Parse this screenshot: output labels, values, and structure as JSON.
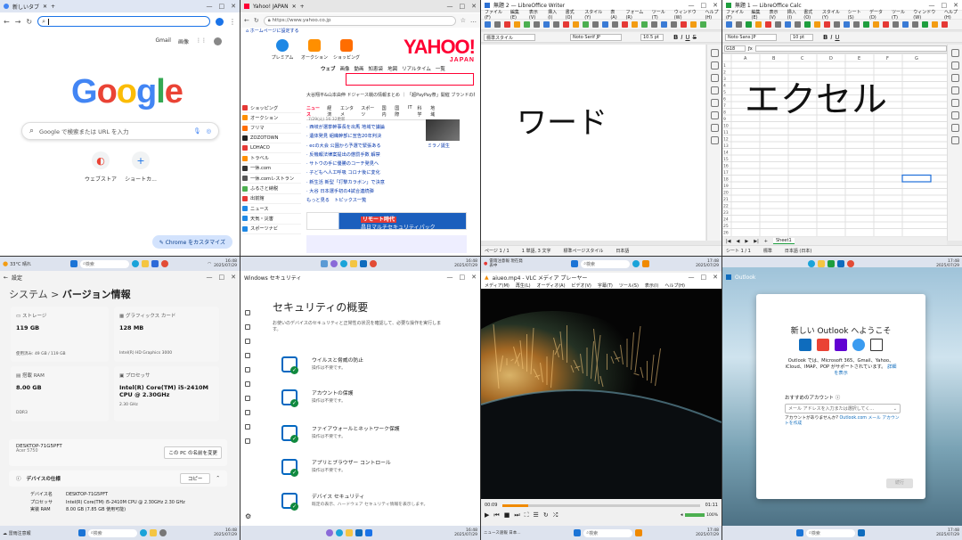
{
  "chrome": {
    "tab_title": "新しいタブ",
    "top_links": [
      "Gmail",
      "画像"
    ],
    "logo": "Google",
    "logo_colors": [
      "#4285f4",
      "#ea4335",
      "#fbbc05",
      "#4285f4",
      "#34a853",
      "#ea4335"
    ],
    "search_placeholder": "Google で検索または URL を入力",
    "shortcuts": [
      "ウェブストア",
      "ショートカ..."
    ],
    "customize_label": "Chrome をカスタマイズ"
  },
  "edge_yahoo": {
    "tab_title": "Yahoo! JAPAN",
    "url": "https://www.yahoo.co.jp",
    "favorites_bar": "ホームページに設定する",
    "logo": "YAHOO!",
    "logo_sub": "JAPAN",
    "services": [
      "プレミアム",
      "オークション",
      "ショッピング"
    ],
    "search_tabs": [
      "ウェブ",
      "画像",
      "動画",
      "知恵袋",
      "地図",
      "リアルタイム",
      "一覧"
    ],
    "ticker": "大谷翔平&山本由伸 ドジャース戦の情報まとめ ｜ 「超PayPay祭」開催 ブランドの祭典も今日からキャンペーン",
    "sidebar": [
      "ショッピング",
      "オークション",
      "フリマ",
      "ZOZOTOWN",
      "LOHACO",
      "トラベル",
      "一休.com",
      "一休.comレストラン",
      "ふるさと納税",
      "出前館",
      "ニュース",
      "天気・災害",
      "スポーツナビ"
    ],
    "news_tabs": [
      "ニュース",
      "経済",
      "エンタメ",
      "スポーツ",
      "国内",
      "国際",
      "IT",
      "科学",
      "地域"
    ],
    "news_date": "7/29(火) 16:32更新",
    "news": [
      "· 西岐が選挙幹事長を出馬 地域で議論",
      "· 遺体発見 組織幹部に宣告20年判決",
      "· ecの大会 公園から予選で緊張ある",
      "· 反機報法律案提出の懲罰手数 解禁",
      "· サトウの手に優勝のコーチ発見へ",
      "· 子どもへ人工呼吸 コロナ後に変化",
      "· 新生活 新型「打撃カラボン」で決意",
      "· 大谷 日本選手初の4試合連続弾",
      "もっと見る　トピックス一覧"
    ],
    "news_image_caption": "ミラノ誕生",
    "banner_title": "リモート時代",
    "banner_text": "昌日マルチセキュリティパック"
  },
  "writer": {
    "title": "無題 2 — LibreOffice Writer",
    "menus": [
      "ファイル(F)",
      "編集(E)",
      "表示(V)",
      "挿入(I)",
      "書式(O)",
      "スタイル(Y)",
      "表(A)",
      "フォーム(R)",
      "ツール(T)",
      "ウィンドウ(W)",
      "ヘルプ(H)"
    ],
    "style_box": "標準スタイル",
    "font_box": "Noto Serif JP",
    "size_box": "10.5 pt",
    "body_text": "ワード",
    "status": [
      "ページ 1 / 1",
      "1 単語, 3 文字",
      "標準ページスタイル",
      "日本語"
    ]
  },
  "calc": {
    "title": "無題 1 — LibreOffice Calc",
    "menus": [
      "ファイル(F)",
      "編集(E)",
      "表示(V)",
      "挿入(I)",
      "書式(O)",
      "スタイル(Y)",
      "シート(S)",
      "データ(D)",
      "ツール(T)",
      "ウィンドウ(W)",
      "ヘルプ(H)"
    ],
    "font_box": "Noto Sans JP",
    "size_box": "10 pt",
    "cell_ref": "G18",
    "columns": [
      "A",
      "B",
      "C",
      "D",
      "E",
      "F",
      "G"
    ],
    "cell_text": "エクセル",
    "sheet_tab": "Sheet1",
    "status": [
      "シート 1 / 1",
      "標準",
      "日本語 (日本)"
    ]
  },
  "settings": {
    "app_title": "設定",
    "breadcrumb_system": "システム",
    "breadcrumb_sep": ">",
    "breadcrumb_page": "バージョン情報",
    "specs": [
      {
        "label": "ストレージ",
        "value": "119 GB",
        "sub": "使用済み: 49 GB / 119 GB"
      },
      {
        "label": "グラフィックス カード",
        "value": "128 MB",
        "sub": "Intel(R) HD Graphics 3000"
      },
      {
        "label": "搭載 RAM",
        "value": "8.00 GB",
        "sub": "DDR3"
      },
      {
        "label": "プロセッサ",
        "value": "Intel(R) Core(TM) i5-2410M CPU @ 2.30GHz",
        "sub": "2.30 GHz"
      }
    ],
    "device_name": "DESKTOP-71G5PFT",
    "device_model": "Acer 5750",
    "rename_button": "この PC の名前を変更",
    "device_spec_header": "デバイスの仕様",
    "copy_button": "コピー",
    "spec_rows": [
      {
        "k": "デバイス名",
        "v": "DESKTOP-71G5PFT"
      },
      {
        "k": "プロセッサ",
        "v": "Intel(R) Core(TM) i5-2410M CPU @ 2.30GHz   2.30 GHz"
      },
      {
        "k": "実装 RAM",
        "v": "8.00 GB (7.85 GB 使用可能)"
      }
    ],
    "weather": "33°C 晴れ"
  },
  "security": {
    "app_title": "Windows セキュリティ",
    "title": "セキュリティの概要",
    "subtitle": "お使いのデバイスのセキュリティと正常性の状況を確認して、必要な操作を実行します。",
    "items": [
      {
        "title": "ウイルスと脅威の防止",
        "sub": "操作は不要です。"
      },
      {
        "title": "アカウントの保護",
        "sub": "操作は不要です。"
      },
      {
        "title": "ファイアウォールとネットワーク保護",
        "sub": "操作は不要です。"
      },
      {
        "title": "アプリとブラウザー コントロール",
        "sub": "操作は不要です。"
      },
      {
        "title": "デバイス セキュリティ",
        "sub": "既定の表示、ハードウェア セキュリティ情報を表示します。"
      }
    ]
  },
  "vlc": {
    "title": "aiueo.mp4 - VLC メディア プレーヤー",
    "menus": [
      "メディア(M)",
      "再生(L)",
      "オーディオ(A)",
      "ビデオ(V)",
      "字幕(T)",
      "ツール(S)",
      "表示(I)",
      "ヘルプ(H)"
    ],
    "time_current": "00:09",
    "time_total": "01:11",
    "progress": 0.13,
    "volume_label": "100%",
    "weather": "雷雨注意報 現在発表中"
  },
  "outlook": {
    "app_title": "Outlook",
    "welcome": "新しい Outlook へようこそ",
    "provider_icons": [
      "outlook-icon",
      "gmail-icon",
      "yahoo-icon",
      "icloud-icon",
      "mail-icon"
    ],
    "description": "Outlook では、Microsoft 365、Gmail、Yahoo、iCloud、IMAP、POP がサポートされています。",
    "details_link": "詳細を表示",
    "recommended_label": "おすすめのアカウント",
    "email_placeholder": "メール アドレスを入力または選択してく...",
    "no_account_text": "アカウントがありませんか?",
    "create_link": "Outlook.com メール アカウントを作成",
    "continue_button": "続行",
    "weather": "雷雨注意報 現在発表中",
    "weather2": "ニュース速報 日本..."
  },
  "clock": {
    "times": [
      "16:48",
      "16:48",
      "17:48",
      "17:48"
    ],
    "dates": [
      "2025/07/29",
      "2025/07/29",
      "2025/07/29",
      "2025/07/29"
    ]
  },
  "taskbar": {
    "search_label": "検索"
  }
}
